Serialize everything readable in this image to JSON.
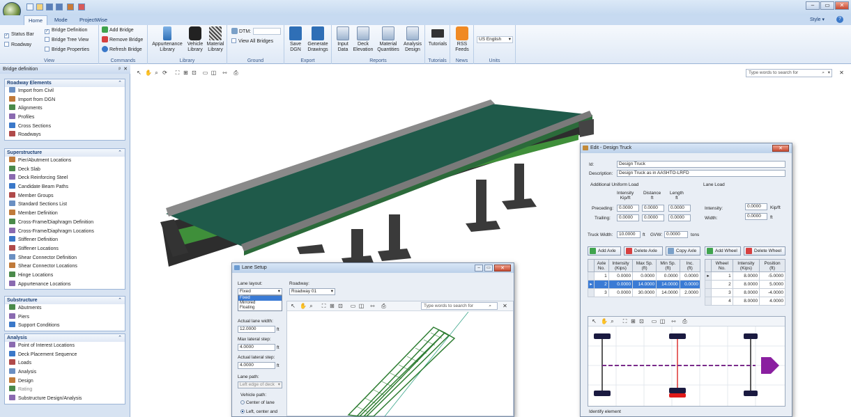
{
  "title_bar": {
    "style_label": "Style"
  },
  "tabs": [
    "Home",
    "Mode",
    "ProjectWise"
  ],
  "ribbon": {
    "view": {
      "label": "View",
      "status_bar": "Status Bar",
      "roadway": "Roadway",
      "bridge_definition": "Bridge Definition",
      "bridge_tree_view": "Bridge Tree View",
      "bridge_properties": "Bridge Properties"
    },
    "commands": {
      "label": "Commands",
      "add_bridge": "Add Bridge",
      "remove_bridge": "Remove Bridge",
      "refresh_bridge": "Refresh Bridge"
    },
    "library": {
      "label": "Library",
      "appurtenance": "Appurtenance\nLibrary",
      "vehicle": "Vehicle\nLibrary",
      "material": "Material\nLibrary"
    },
    "ground": {
      "label": "Ground",
      "dtm": "DTM:",
      "view_all_bridges": "View All Bridges"
    },
    "export": {
      "label": "Export",
      "save_dgn": "Save\nDGN",
      "generate_drawings": "Generate\nDrawings"
    },
    "reports": {
      "label": "Reports",
      "input_data": "Input\nData",
      "deck_elevation": "Deck\nElevation",
      "material_quantities": "Material\nQuantities",
      "analysis_design": "Analysis\nDesign"
    },
    "tutorials": {
      "label": "Tutorials",
      "tutorials_btn": "Tutorials"
    },
    "news": {
      "label": "News",
      "rss": "RSS\nFeeds"
    },
    "units": {
      "label": "Units",
      "value": "US English"
    }
  },
  "left_panel": {
    "title": "Bridge definition",
    "sections": [
      {
        "title": "Roadway Elements",
        "items": [
          "Import from Civil",
          "Import from DGN",
          "Alignments",
          "Profiles",
          "Cross Sections",
          "Roadways"
        ]
      },
      {
        "title": "Superstructure",
        "items": [
          "Pier/Abutment Locations",
          "Deck Slab",
          "Deck Reinforcing Steel",
          "Candidate Beam Paths",
          "Member Groups",
          "Standard Sections List",
          "Member Definition",
          "Cross-Frame/Diaphragm Definition",
          "Cross-Frame/Diaphragm Locations",
          "Stiffener Definition",
          "Stiffener Locations",
          "Shear Connector Definition",
          "Shear Connector Locations",
          "Hinge Locations",
          "Appurtenance Locations"
        ]
      },
      {
        "title": "Substructure",
        "items": [
          "Abutments",
          "Piers",
          "Support Conditions"
        ]
      },
      {
        "title": "Analysis",
        "items": [
          "Point of Interest Locations",
          "Deck Placement Sequence",
          "Loads",
          "Analysis",
          "Design",
          "Rating",
          "Substructure Design/Analysis"
        ]
      }
    ]
  },
  "main": {
    "search_placeholder": "Type words to search for"
  },
  "design_truck": {
    "title": "Edit - Design Truck",
    "id_label": "Id:",
    "id_value": "Design Truck",
    "desc_label": "Description:",
    "desc_value": "Design Truck as in AASHTO-LRFD",
    "additional_uniform_load": "Additional Uniform Load",
    "col_intensity": "Intensity\nKip/ft",
    "col_distance": "Distance\nft",
    "col_length": "Length\nft",
    "preceding_label": "Preceding:",
    "trailing_label": "Trailing:",
    "preceding": [
      "0.0000",
      "0.0000",
      "0.0000"
    ],
    "trailing": [
      "0.0000",
      "0.0000",
      "0.0000"
    ],
    "lane_load": "Lane Load",
    "lane_intensity_label": "Intensity:",
    "lane_intensity": "0.0000",
    "lane_intensity_unit": "Kip/ft",
    "lane_width_label": "Width:",
    "lane_width": "0.0000",
    "lane_width_unit": "ft",
    "truck_width_label": "Truck Width:",
    "truck_width": "10.0000",
    "truck_width_unit": "ft",
    "gvw_label": "GVW:",
    "gvw": "0.0000",
    "gvw_unit": "tons",
    "add_axle": "Add Axle",
    "delete_axle": "Delete Axle",
    "copy_axle": "Copy Axle",
    "add_wheel": "Add Wheel",
    "delete_wheel": "Delete Wheel",
    "axle_headers": [
      "Axle\nNo.",
      "Intensity\n(Kips)",
      "Max Sp.\n(ft)",
      "Min Sp.\n(ft)",
      "Inc.\n(ft)"
    ],
    "axles": [
      [
        "1",
        "0.0000",
        "0.0000",
        "0.0000",
        "0.0000"
      ],
      [
        "2",
        "0.0000",
        "14.0000",
        "14.0000",
        "0.0000"
      ],
      [
        "3",
        "0.0000",
        "30.0000",
        "14.0000",
        "2.0000"
      ]
    ],
    "wheel_headers": [
      "Wheel\nNo.",
      "Intensity\n(Kips)",
      "Position\n(ft)"
    ],
    "wheels": [
      [
        "1",
        "8.0000",
        "-5.0000"
      ],
      [
        "2",
        "8.0000",
        "5.0000"
      ],
      [
        "3",
        "8.0000",
        "-4.0000"
      ],
      [
        "4",
        "8.0000",
        "4.0000"
      ]
    ],
    "status": "Identify element"
  },
  "lane_setup": {
    "title": "Lane Setup",
    "lane_layout_label": "Lane layout:",
    "lane_layout_value": "Fixed",
    "lane_layout_options": [
      "Fixed",
      "Mirrored",
      "Floating"
    ],
    "roadway_label": "Roadway:",
    "roadway_value": "Roadway 01",
    "actual_lane_width_label": "Actual lane width:",
    "actual_lane_width": "12.0000",
    "unit_ft": "ft",
    "max_lateral_step_label": "Max lateral step:",
    "max_lateral_step": "4.0000",
    "actual_lateral_step_label": "Actual lateral step:",
    "actual_lateral_step": "4.0000",
    "lane_path_label": "Lane path:",
    "lane_path_value": "Left edge of deck",
    "vehicle_path_label": "Vehicle path:",
    "center_of_lane": "Center of lane",
    "left_center_and": "Left, center and",
    "search_placeholder": "Type words to search for"
  }
}
